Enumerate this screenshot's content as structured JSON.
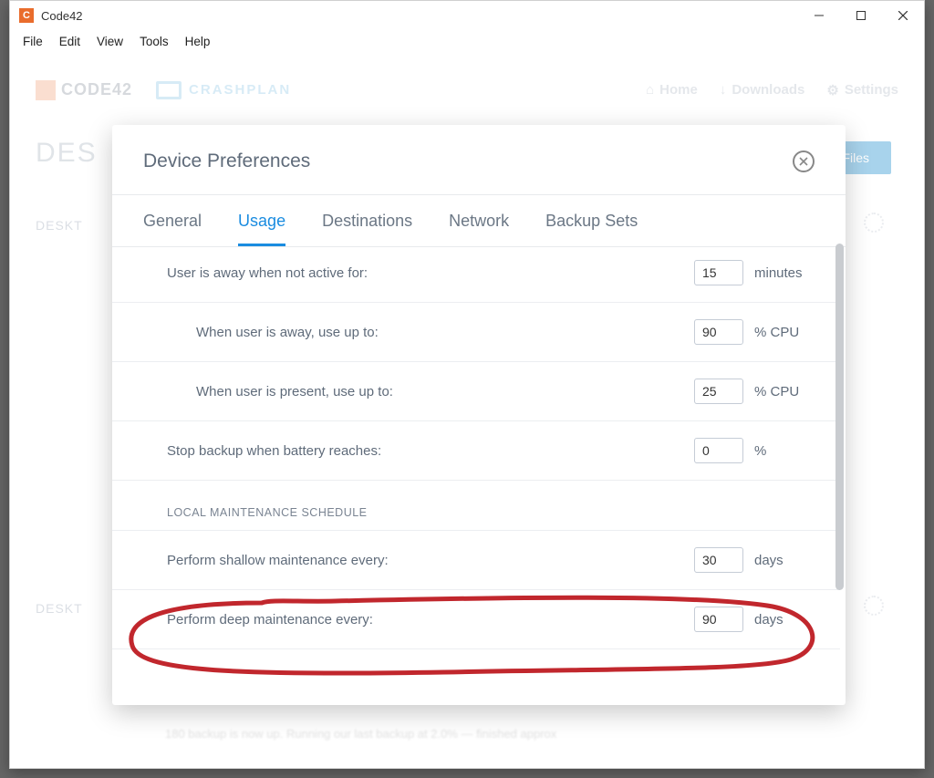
{
  "window": {
    "title": "Code42",
    "menu": [
      "File",
      "Edit",
      "View",
      "Tools",
      "Help"
    ]
  },
  "background": {
    "logo1": "CODE42",
    "logo2": "CRASHPLAN",
    "nav": {
      "home": "Home",
      "downloads": "Downloads",
      "settings": "Settings"
    },
    "title_fragment": "DES",
    "files_btn": "Files",
    "section1": "DESKT",
    "section2": "DESKT",
    "blur_text": "180 backup is now up. Running our last backup at 2.0% — finished approx"
  },
  "modal": {
    "title": "Device Preferences",
    "tabs": [
      "General",
      "Usage",
      "Destinations",
      "Network",
      "Backup Sets"
    ],
    "active_tab": "Usage",
    "rows": {
      "away_label": "User is away when not active for:",
      "away_value": "15",
      "away_unit": "minutes",
      "cpu_away_label": "When user is away, use up to:",
      "cpu_away_value": "90",
      "cpu_away_unit": "% CPU",
      "cpu_present_label": "When user is present, use up to:",
      "cpu_present_value": "25",
      "cpu_present_unit": "% CPU",
      "battery_label": "Stop backup when battery reaches:",
      "battery_value": "0",
      "battery_unit": "%",
      "section_header": "LOCAL MAINTENANCE SCHEDULE",
      "shallow_label": "Perform shallow maintenance every:",
      "shallow_value": "30",
      "shallow_unit": "days",
      "deep_label": "Perform deep maintenance every:",
      "deep_value": "90",
      "deep_unit": "days"
    }
  }
}
